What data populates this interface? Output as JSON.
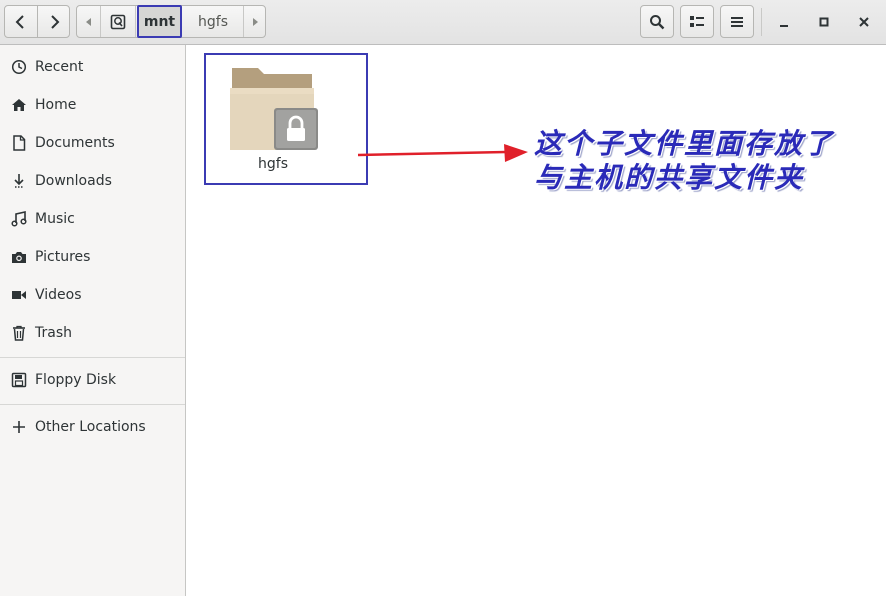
{
  "header": {
    "path": [
      {
        "label": "",
        "icon": "drive-icon"
      },
      {
        "label": "mnt",
        "active": true
      },
      {
        "label": "hgfs",
        "active": false
      }
    ]
  },
  "sidebar": {
    "places": [
      {
        "label": "Recent",
        "icon": "clock-icon"
      },
      {
        "label": "Home",
        "icon": "home-icon"
      },
      {
        "label": "Documents",
        "icon": "document-icon"
      },
      {
        "label": "Downloads",
        "icon": "download-icon"
      },
      {
        "label": "Music",
        "icon": "music-icon"
      },
      {
        "label": "Pictures",
        "icon": "camera-icon"
      },
      {
        "label": "Videos",
        "icon": "video-icon"
      },
      {
        "label": "Trash",
        "icon": "trash-icon"
      }
    ],
    "devices": [
      {
        "label": "Floppy Disk",
        "icon": "floppy-icon"
      }
    ],
    "other": {
      "label": "Other Locations",
      "icon": "plus-icon"
    }
  },
  "main": {
    "items": [
      {
        "name": "hgfs",
        "icon": "locked-folder-icon"
      }
    ]
  },
  "annotation": {
    "line1": "这个子文件里面存放了",
    "line2": "与主机的共享文件夹",
    "color": "#2a2ab8",
    "arrow_color": "#e0202a"
  },
  "colors": {
    "highlight_border": "#3b3bb3",
    "sidebar_bg": "#f6f5f4"
  }
}
